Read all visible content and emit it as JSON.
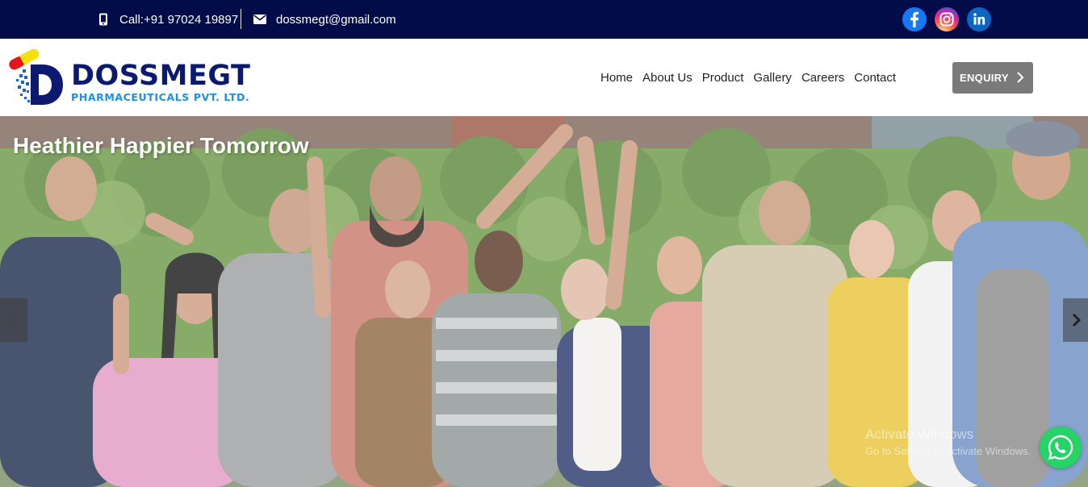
{
  "topbar": {
    "phone_text": "Call:+91 97024 19897",
    "email_text": "dossmegt@gmail.com",
    "social": [
      {
        "name": "facebook",
        "icon": "facebook-icon"
      },
      {
        "name": "instagram",
        "icon": "instagram-icon"
      },
      {
        "name": "linkedin",
        "icon": "linkedin-icon"
      }
    ],
    "colors": {
      "background": "#020c48"
    }
  },
  "header": {
    "logo_name": "DOSSMEGT",
    "logo_subtitle": "PHARMACEUTICALS PVT. LTD.",
    "nav": [
      "Home",
      "About Us",
      "Product",
      "Gallery",
      "Careers",
      "Contact"
    ],
    "enquiry_label": "ENQUIRY",
    "colors": {
      "brand_dark": "#0b1a6e",
      "brand_light": "#1f8fe0",
      "enquiry_bg": "#7a7a7a"
    }
  },
  "hero": {
    "title": "Heathier Happier Tomorrow",
    "image": "group of cheering people in front of greenery"
  },
  "watermark": {
    "line1": "Activate Windows",
    "line2": "Go to Settings to activate Windows."
  },
  "whatsapp": {
    "icon": "whatsapp-icon",
    "color": "#25d366"
  }
}
